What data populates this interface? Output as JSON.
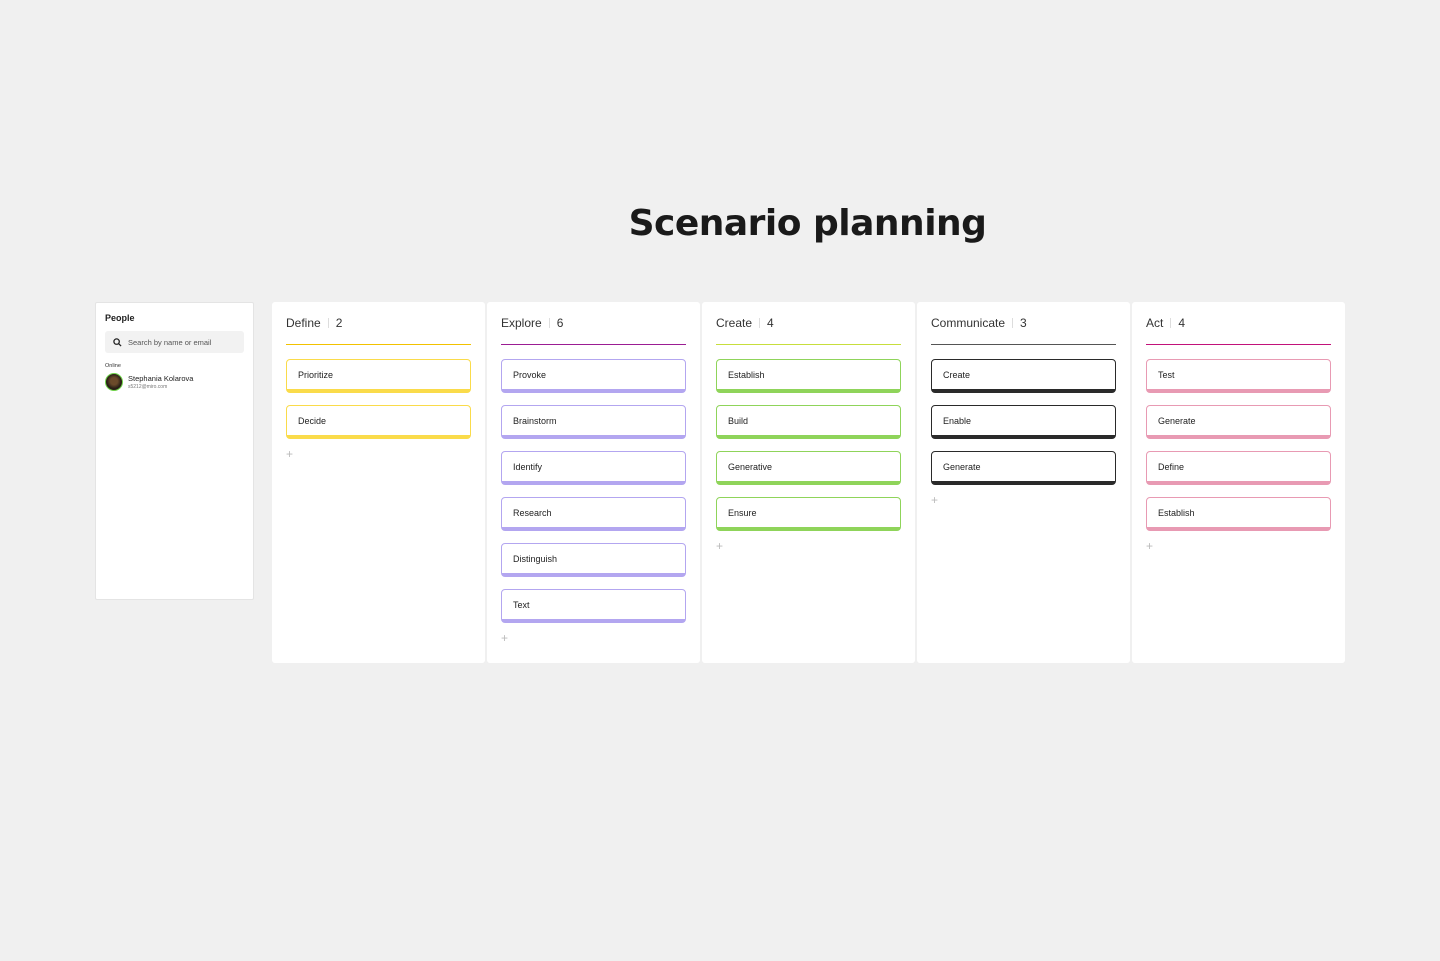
{
  "board": {
    "title": "Scenario planning"
  },
  "people": {
    "heading": "People",
    "search_placeholder": "Search by name or email",
    "online_label": "Online",
    "users": [
      {
        "name": "Stephania Kolarova",
        "email": "s5212@miro.com"
      }
    ]
  },
  "columns": [
    {
      "title": "Define",
      "count": "2",
      "line_color": "#f2c200",
      "card_color": "#fadb4a",
      "cards": [
        "Prioritize",
        "Decide"
      ],
      "add_label": "+"
    },
    {
      "title": "Explore",
      "count": "6",
      "line_color": "#9b1d93",
      "card_color": "#b3a6f0",
      "cards": [
        "Provoke",
        "Brainstorm",
        "Identify",
        "Research",
        "Distinguish",
        "Text"
      ],
      "add_label": "+"
    },
    {
      "title": "Create",
      "count": "4",
      "line_color": "#c7de3c",
      "card_color": "#8fd45a",
      "cards": [
        "Establish",
        "Build",
        "Generative",
        "Ensure"
      ],
      "add_label": "+"
    },
    {
      "title": "Communicate",
      "count": "3",
      "line_color": "#555555",
      "card_color": "#2a2a2a",
      "cards": [
        "Create",
        "Enable",
        "Generate"
      ],
      "add_label": "+"
    },
    {
      "title": "Act",
      "count": "4",
      "line_color": "#c2127a",
      "card_color": "#e89ab3",
      "cards": [
        "Test",
        "Generate",
        "Define",
        "Establish"
      ],
      "add_label": "+"
    }
  ]
}
